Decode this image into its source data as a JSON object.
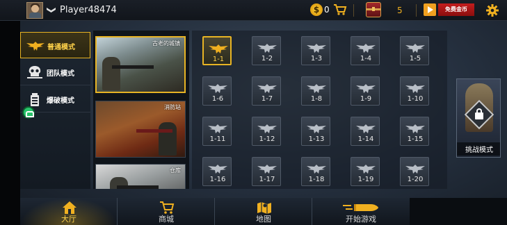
{
  "topbar": {
    "player_name": "Player48474",
    "coin_symbol": "$",
    "coin_count": "0",
    "chest_count": "5",
    "free_gold_label": "免费金币"
  },
  "modes": [
    {
      "label": "普通模式",
      "icon": "eagle-icon",
      "active": true
    },
    {
      "label": "团队模式",
      "icon": "team-skull-icon",
      "active": false
    },
    {
      "label": "爆破模式",
      "icon": "bomb-icon",
      "active": false
    }
  ],
  "maps": [
    {
      "title": "古老的城镇",
      "selected": true
    },
    {
      "title": "消防站",
      "selected": false
    },
    {
      "title": "仓库",
      "selected": false
    }
  ],
  "levels": [
    "1-1",
    "1-2",
    "1-3",
    "1-4",
    "1-5",
    "1-6",
    "1-7",
    "1-8",
    "1-9",
    "1-10",
    "1-11",
    "1-12",
    "1-13",
    "1-14",
    "1-15",
    "1-16",
    "1-17",
    "1-18",
    "1-19",
    "1-20"
  ],
  "selected_level": "1-1",
  "challenge": {
    "label": "挑战模式",
    "locked": true
  },
  "nav": [
    {
      "label": "大厅",
      "icon": "home-icon",
      "active": true
    },
    {
      "label": "商城",
      "icon": "cart-icon",
      "active": false
    },
    {
      "label": "地图",
      "icon": "map-icon",
      "active": false
    },
    {
      "label": "开始游戏",
      "icon": "bullet-icon",
      "active": false
    }
  ],
  "colors": {
    "accent": "#e8b424",
    "danger": "#c41d1d"
  }
}
